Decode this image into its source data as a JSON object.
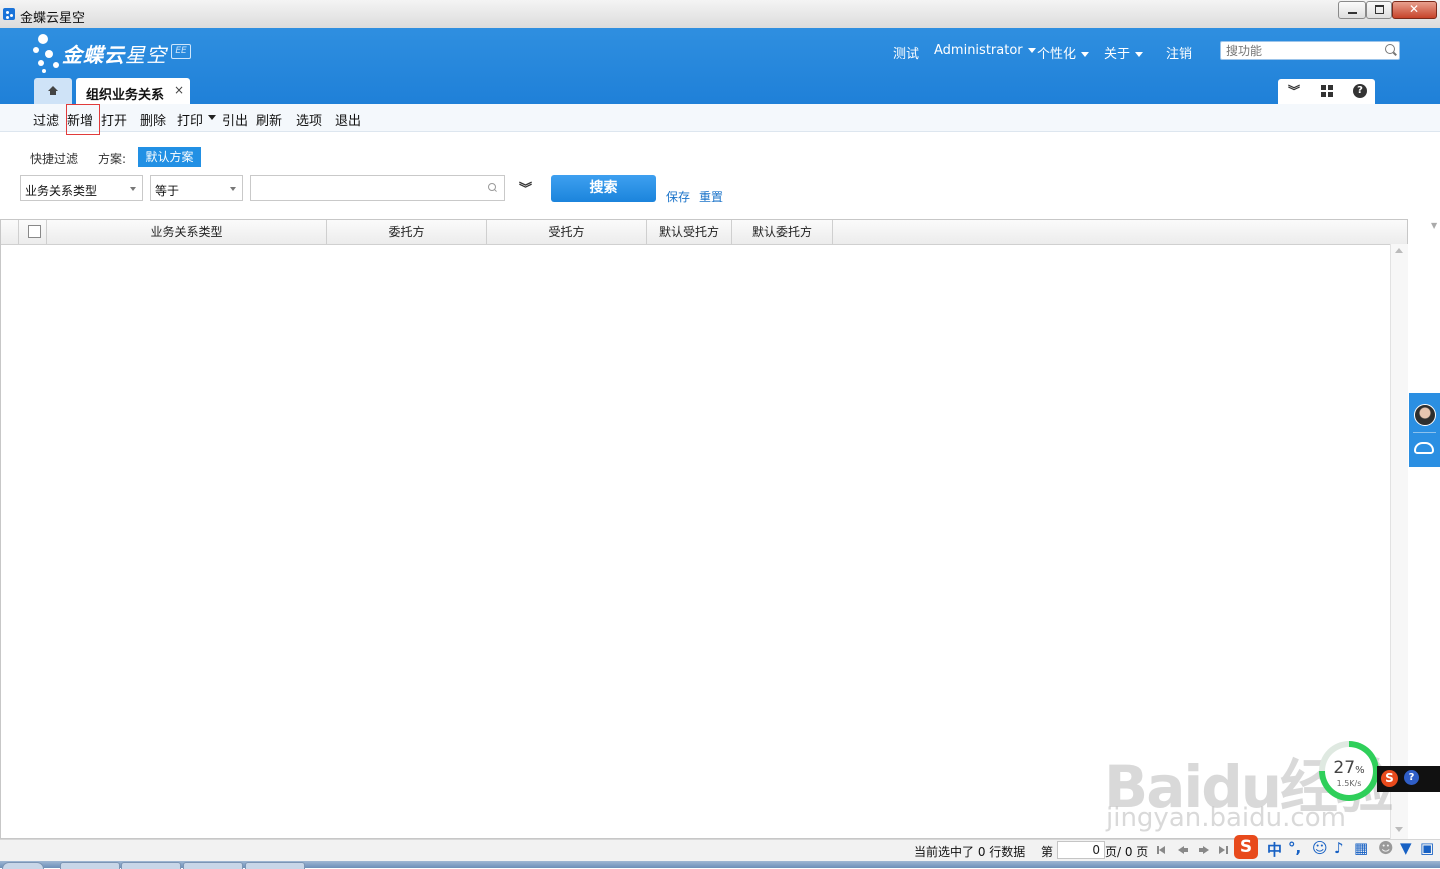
{
  "window": {
    "title": "金蝶云星空"
  },
  "header": {
    "logo_text": "金蝶云",
    "logo_text_2": "星空",
    "logo_badge": "EE",
    "nav": {
      "test": "测试",
      "user": "Administrator",
      "personalize": "个性化",
      "about": "关于",
      "logout": "注销"
    },
    "search_placeholder": "搜功能"
  },
  "tabs": {
    "home_icon": "home-icon",
    "active_label": "组织业务关系",
    "close_glyph": "×"
  },
  "toolbar": {
    "items": [
      "过滤",
      "新增",
      "打开",
      "删除",
      "打印",
      "引出",
      "刷新",
      "选项",
      "退出"
    ]
  },
  "filter": {
    "quick_filter_label": "快捷过滤",
    "scheme_label": "方案:",
    "scheme_value": "默认方案",
    "field_value": "业务关系类型",
    "operator_value": "等于",
    "value_text": "",
    "search_label": "搜索",
    "save_label": "保存",
    "reset_label": "重置"
  },
  "grid": {
    "columns": [
      "业务关系类型",
      "委托方",
      "受托方",
      "默认受托方",
      "默认委托方"
    ],
    "rows": []
  },
  "network_widget": {
    "percent": "27",
    "percent_sign": "%",
    "speed": "1.5K/s"
  },
  "watermark": {
    "main": "Baidu经验",
    "sub": "jingyan.baidu.com"
  },
  "statusbar": {
    "selected_text": "当前选中了 0 行数据",
    "page_prefix": "第",
    "page_value": "0",
    "page_total": "页/ 0 页"
  },
  "tray": {
    "ime_logo": "S",
    "ime_mode": "中",
    "ime_punct": "°,"
  },
  "colors": {
    "header_blue": "#2289dd",
    "accent": "#2290e4",
    "link": "#1a73c9"
  }
}
